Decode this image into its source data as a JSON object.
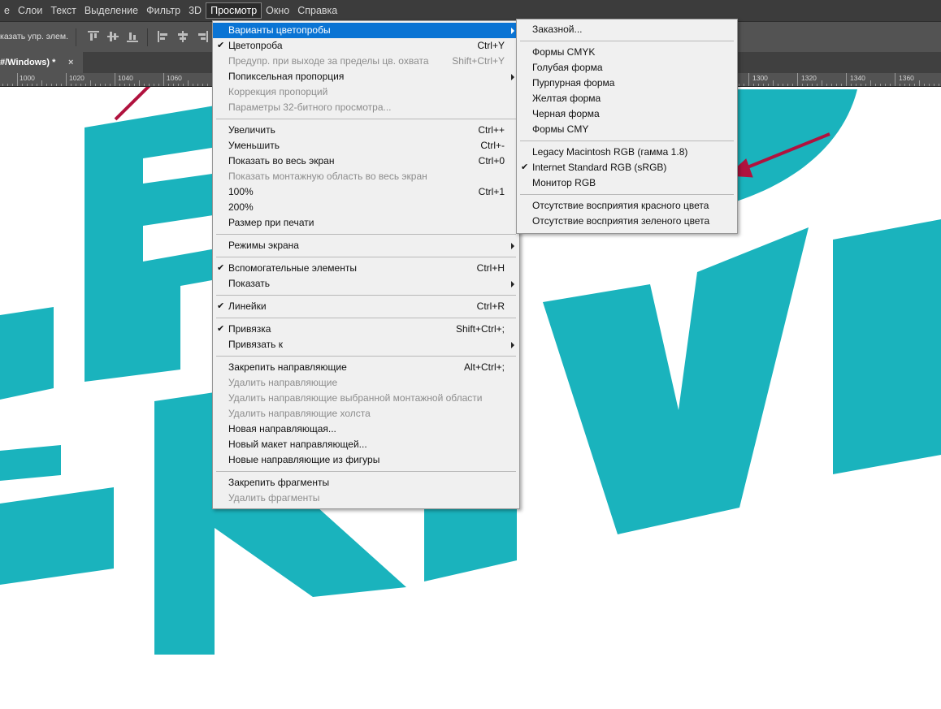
{
  "menubar": {
    "items": [
      "е",
      "Слои",
      "Текст",
      "Выделение",
      "Фильтр",
      "3D",
      "Просмотр",
      "Окно",
      "Справка"
    ],
    "active_index": 6
  },
  "options_bar": {
    "label": "казать упр. элем."
  },
  "document_tab": {
    "title": "#/Windows) *",
    "close": "×"
  },
  "ruler": {
    "labels": [
      "1000",
      "1020",
      "1040",
      "1060",
      "1300",
      "1320",
      "1340",
      "1360"
    ]
  },
  "view_menu": {
    "items": [
      {
        "label": "Варианты цветопробы",
        "submenu": true,
        "highlighted": true
      },
      {
        "label": "Цветопроба",
        "shortcut": "Ctrl+Y",
        "checked": true
      },
      {
        "label": "Предупр. при выходе за пределы цв. охвата",
        "shortcut": "Shift+Ctrl+Y",
        "disabled": true
      },
      {
        "label": "Попиксельная пропорция",
        "submenu": true
      },
      {
        "label": "Коррекция пропорций",
        "disabled": true
      },
      {
        "label": "Параметры 32-битного просмотра...",
        "disabled": true
      },
      {
        "separator": true
      },
      {
        "label": "Увеличить",
        "shortcut": "Ctrl++"
      },
      {
        "label": "Уменьшить",
        "shortcut": "Ctrl+-"
      },
      {
        "label": "Показать во весь экран",
        "shortcut": "Ctrl+0"
      },
      {
        "label": "Показать монтажную область во весь экран",
        "disabled": true
      },
      {
        "label": "100%",
        "shortcut": "Ctrl+1"
      },
      {
        "label": "200%"
      },
      {
        "label": "Размер при печати"
      },
      {
        "separator": true
      },
      {
        "label": "Режимы экрана",
        "submenu": true
      },
      {
        "separator": true
      },
      {
        "label": "Вспомогательные элементы",
        "shortcut": "Ctrl+H",
        "checked": true
      },
      {
        "label": "Показать",
        "submenu": true
      },
      {
        "separator": true
      },
      {
        "label": "Линейки",
        "shortcut": "Ctrl+R",
        "checked": true
      },
      {
        "separator": true
      },
      {
        "label": "Привязка",
        "shortcut": "Shift+Ctrl+;",
        "checked": true
      },
      {
        "label": "Привязать к",
        "submenu": true
      },
      {
        "separator": true
      },
      {
        "label": "Закрепить направляющие",
        "shortcut": "Alt+Ctrl+;"
      },
      {
        "label": "Удалить направляющие",
        "disabled": true
      },
      {
        "label": "Удалить направляющие выбранной монтажной области",
        "disabled": true
      },
      {
        "label": "Удалить направляющие холста",
        "disabled": true
      },
      {
        "label": "Новая направляющая..."
      },
      {
        "label": "Новый макет направляющей..."
      },
      {
        "label": "Новые направляющие из фигуры"
      },
      {
        "separator": true
      },
      {
        "label": "Закрепить фрагменты"
      },
      {
        "label": "Удалить фрагменты",
        "disabled": true
      }
    ]
  },
  "proof_submenu": {
    "items": [
      {
        "label": "Заказной..."
      },
      {
        "separator": true
      },
      {
        "label": "Формы CMYK"
      },
      {
        "label": "Голубая форма"
      },
      {
        "label": "Пурпурная форма"
      },
      {
        "label": "Желтая форма"
      },
      {
        "label": "Черная форма"
      },
      {
        "label": "Формы CMY"
      },
      {
        "separator": true
      },
      {
        "label": "Legacy Macintosh RGB (гамма 1.8)"
      },
      {
        "label": "Internet Standard RGB (sRGB)",
        "checked": true
      },
      {
        "label": "Монитор RGB"
      },
      {
        "separator": true
      },
      {
        "label": "Отсутствие восприятия красного цвета"
      },
      {
        "label": "Отсутствие восприятия зеленого цвета"
      }
    ]
  },
  "colors": {
    "menubar_bg": "#3c3c3c",
    "toolbar_bg": "#535353",
    "menu_bg": "#f0f0f0",
    "highlight": "#0a74d4",
    "artwork_teal": "#1ab3bd",
    "annotation_arrow": "#b0123e"
  },
  "check_glyph": "✔"
}
